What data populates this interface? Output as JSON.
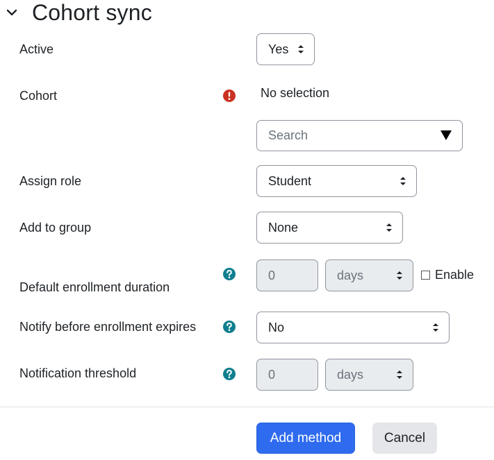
{
  "section": {
    "title": "Cohort sync"
  },
  "fields": {
    "active": {
      "label": "Active",
      "value": "Yes"
    },
    "cohort": {
      "label": "Cohort",
      "selection": "No selection",
      "search_placeholder": "Search"
    },
    "assign_role": {
      "label": "Assign role",
      "value": "Student"
    },
    "add_to_group": {
      "label": "Add to group",
      "value": "None"
    },
    "default_duration": {
      "label": "Default enrollment duration",
      "number": "0",
      "unit": "days",
      "enable_label": "Enable"
    },
    "notify": {
      "label": "Notify before enrollment expires",
      "value": "No"
    },
    "threshold": {
      "label": "Notification threshold",
      "number": "0",
      "unit": "days"
    }
  },
  "buttons": {
    "add_method": "Add method",
    "cancel": "Cancel"
  },
  "icons": {
    "collapse": "chevron-down-icon",
    "error": "error-icon",
    "help": "help-icon",
    "dropdown": "triangle-down-icon",
    "select": "sort-caret-icon"
  },
  "colors": {
    "primary": "#2f6bef",
    "error": "#ca3120",
    "help": "#0f6cbf"
  }
}
